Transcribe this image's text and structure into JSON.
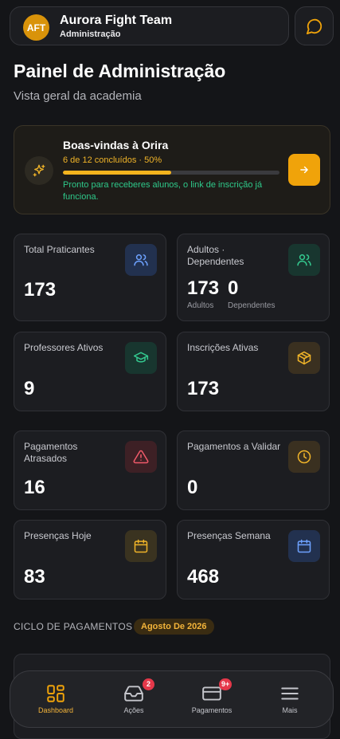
{
  "header": {
    "avatar_initials": "AFT",
    "team_name": "Aurora Fight Team",
    "role": "Administração",
    "chat_icon": "chat-bubble-icon"
  },
  "page": {
    "title": "Painel de Administração",
    "subtitle": "Vista geral da academia"
  },
  "welcome": {
    "title": "Boas-vindas à Orira",
    "progress_text": "6 de 12 concluídos · 50%",
    "progress_fraction": 0.5,
    "note": "Pronto para receberes alunos, o link de inscrição já funciona.",
    "icon": "sparkles-icon",
    "action_icon": "arrow-right-icon"
  },
  "stats": {
    "total": {
      "label": "Total Praticantes",
      "value": "173",
      "icon": "users-icon"
    },
    "adults_dependents": {
      "label": "Adultos · Dependentes",
      "adults_value": "173",
      "adults_label": "Adultos",
      "dependents_value": "0",
      "dependents_label": "Dependentes",
      "icon": "users-icon"
    },
    "teachers": {
      "label": "Professores Ativos",
      "value": "9",
      "icon": "graduation-cap-icon"
    },
    "enrollments": {
      "label": "Inscrições Ativas",
      "value": "173",
      "icon": "package-icon"
    },
    "late_payments": {
      "label": "Pagamentos Atrasados",
      "value": "16",
      "icon": "alert-triangle-icon"
    },
    "pending_payments": {
      "label": "Pagamentos a Validar",
      "value": "0",
      "icon": "clock-icon"
    },
    "attendance_today": {
      "label": "Presenças Hoje",
      "value": "83",
      "icon": "calendar-icon"
    },
    "attendance_week": {
      "label": "Presenças Semana",
      "value": "468",
      "icon": "calendar-icon"
    }
  },
  "cycle": {
    "title": "CICLO DE PAGAMENTOS",
    "month": "Agosto De 2026"
  },
  "nav": {
    "items": [
      {
        "label": "Dashboard",
        "icon": "dashboard-icon",
        "active": true
      },
      {
        "label": "Ações",
        "icon": "inbox-icon",
        "badge": "2"
      },
      {
        "label": "Pagamentos",
        "icon": "credit-card-icon",
        "badge": "9+"
      },
      {
        "label": "Mais",
        "icon": "menu-icon"
      }
    ]
  },
  "colors": {
    "accent": "#f0a30a",
    "success": "#2ec98a",
    "danger": "#e5384a",
    "background": "#141518"
  }
}
